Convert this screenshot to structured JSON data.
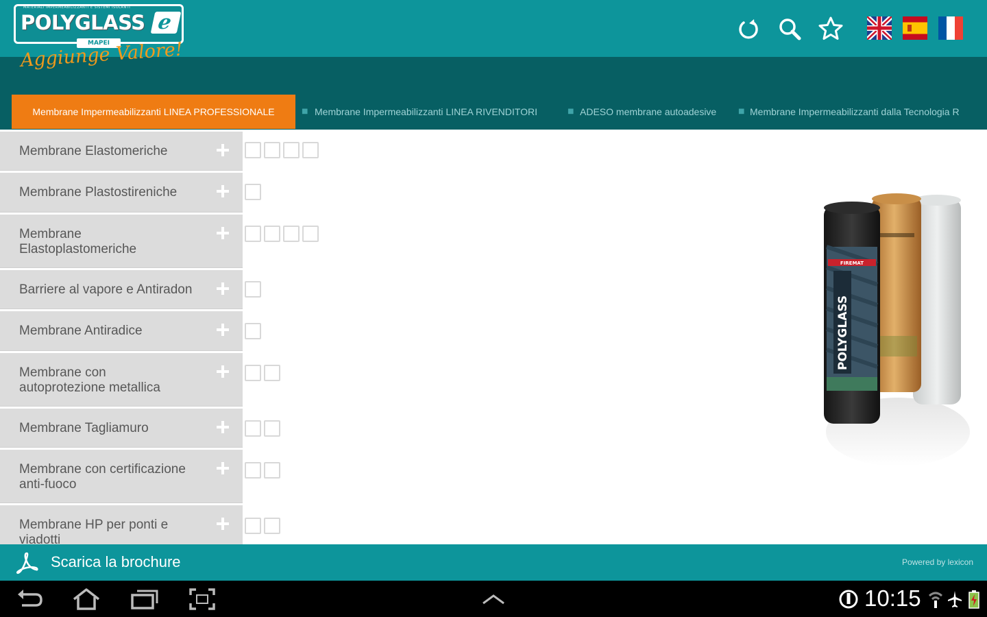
{
  "header": {
    "logo_text": "POLYGLASS",
    "logo_mark": "e",
    "logo_sub": "MAPEI",
    "logo_tagline": "MATERIALI IMPERMEABILIZZANTI E SISTEMI ISOLANTI",
    "slogan": "Aggiunge Valore!",
    "actions": [
      {
        "name": "refresh-icon"
      },
      {
        "name": "search-icon"
      },
      {
        "name": "favorites-star-icon"
      }
    ],
    "languages": [
      "uk-flag",
      "spain-flag",
      "france-flag"
    ]
  },
  "tabs": [
    {
      "label": "Membrane Impermeabilizzanti LINEA PROFESSIONALE",
      "active": true
    },
    {
      "label": "Membrane Impermeabilizzanti LINEA RIVENDITORI",
      "active": false
    },
    {
      "label": "ADESO membrane autoadesive",
      "active": false
    },
    {
      "label": "Membrane Impermeabilizzanti dalla Tecnologia R",
      "active": false
    }
  ],
  "categories": [
    {
      "label": "Membrane Elastomeriche",
      "marks": 4
    },
    {
      "label": "Membrane Plastostireniche",
      "marks": 1
    },
    {
      "label": "Membrane Elastoplastomeriche",
      "marks": 4
    },
    {
      "label": "Barriere al vapore e Antiradon",
      "marks": 1
    },
    {
      "label": "Membrane Antiradice",
      "marks": 1
    },
    {
      "label": "Membrane con autoprotezione metallica",
      "marks": 2
    },
    {
      "label": "Membrane Tagliamuro",
      "marks": 2
    },
    {
      "label": "Membrane con certificazione anti-fuoco",
      "marks": 2
    },
    {
      "label": "Membrane HP per ponti e viadotti",
      "marks": 2
    }
  ],
  "product_image": {
    "roll_label": "POLYGLASS",
    "roll_badge": "FIREMAT"
  },
  "footer": {
    "brochure_label": "Scarica la brochure",
    "powered_by": "Powered by  lexicon"
  },
  "system": {
    "time": "10:15"
  },
  "colors": {
    "teal": "#0d959b",
    "dark_teal": "#075f63",
    "orange": "#ef7c13",
    "sidebar_gray": "#dcdcdc"
  }
}
